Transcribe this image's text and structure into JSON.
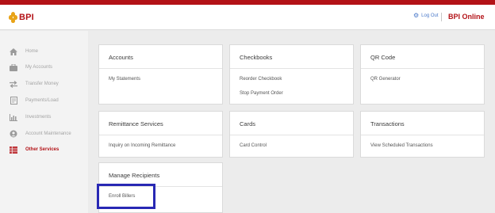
{
  "header": {
    "logo_text": "BPI",
    "logout_label": "Log Out",
    "brand_label": "BPI Online"
  },
  "colors": {
    "brand_red": "#b31217",
    "link_blue": "#4a79c9",
    "highlight_blue": "#2828b4",
    "logo_gold": "#e8a317"
  },
  "sidebar": {
    "items": [
      {
        "label": "Home",
        "icon": "home-icon"
      },
      {
        "label": "My Accounts",
        "icon": "briefcase-icon"
      },
      {
        "label": "Transfer Money",
        "icon": "transfer-arrows-icon"
      },
      {
        "label": "Payments/Load",
        "icon": "document-icon"
      },
      {
        "label": "Investments",
        "icon": "bar-chart-icon"
      },
      {
        "label": "Account Maintenance",
        "icon": "user-circle-icon"
      },
      {
        "label": "Other Services",
        "icon": "grid-list-icon"
      }
    ],
    "active_index": 6
  },
  "cards": {
    "accounts": {
      "title": "Accounts",
      "links": [
        "My Statements"
      ]
    },
    "checkbooks": {
      "title": "Checkbooks",
      "links": [
        "Reorder Checkbook",
        "Stop Payment Order"
      ]
    },
    "qr_code": {
      "title": "QR Code",
      "links": [
        "QR Generator"
      ]
    },
    "remittance": {
      "title": "Remittance Services",
      "links": [
        "Inquiry on Incoming Remittance"
      ]
    },
    "cards": {
      "title": "Cards",
      "links": [
        "Card Control"
      ]
    },
    "transactions": {
      "title": "Transactions",
      "links": [
        "View Scheduled Transactions"
      ]
    },
    "manage_recipients": {
      "title": "Manage Recipients",
      "links": [
        "Enroll Billers"
      ]
    }
  }
}
